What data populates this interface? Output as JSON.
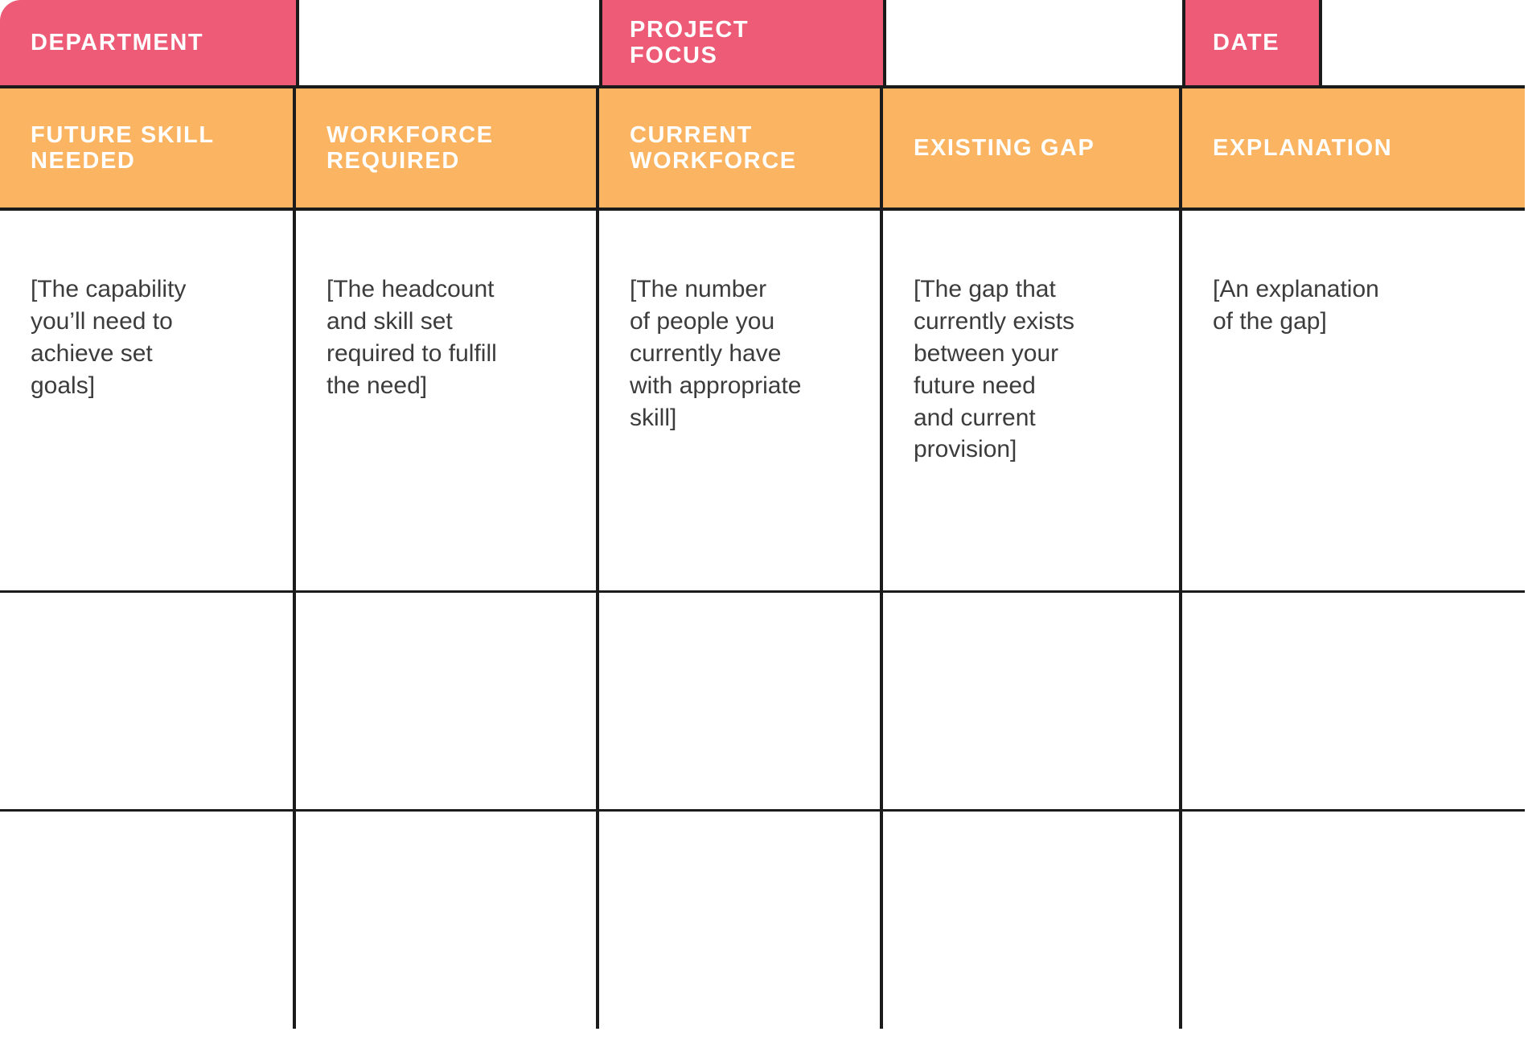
{
  "document": {
    "type": "skills-gap-analysis-table",
    "colors": {
      "pink": "#ED5B76",
      "orange": "#FBB461",
      "border": "#1B1B1B",
      "body_text": "#3C3C3C",
      "header_text": "#FFFFFF",
      "background": "#FFFFFF"
    }
  },
  "title_row": {
    "cells": [
      {
        "label": "DEPARTMENT",
        "style": "pink"
      },
      {
        "label": "",
        "style": "blank"
      },
      {
        "label": "PROJECT\nFOCUS",
        "style": "pink"
      },
      {
        "label": "",
        "style": "blank"
      },
      {
        "label": "DATE",
        "style": "pink"
      },
      {
        "label": "",
        "style": "blank"
      }
    ]
  },
  "header_row": {
    "columns": [
      {
        "label": "FUTURE SKILL\nNEEDED"
      },
      {
        "label": "WORKFORCE\nREQUIRED"
      },
      {
        "label": "CURRENT\nWORKFORCE"
      },
      {
        "label": "EXISTING GAP"
      },
      {
        "label": "EXPLANATION"
      }
    ]
  },
  "body_rows": [
    {
      "cells": [
        "[The capability\nyou’ll need to\nachieve set\ngoals]",
        "[The headcount\nand skill set\nrequired to fulfill\nthe need]",
        "[The number\nof people you\ncurrently have\nwith appropriate\nskill]",
        "[The gap that\ncurrently exists\nbetween your\nfuture need\nand current\nprovision]",
        "[An explanation\nof the gap]"
      ]
    },
    {
      "cells": [
        "",
        "",
        "",
        "",
        ""
      ]
    },
    {
      "cells": [
        "",
        "",
        "",
        "",
        ""
      ]
    }
  ]
}
